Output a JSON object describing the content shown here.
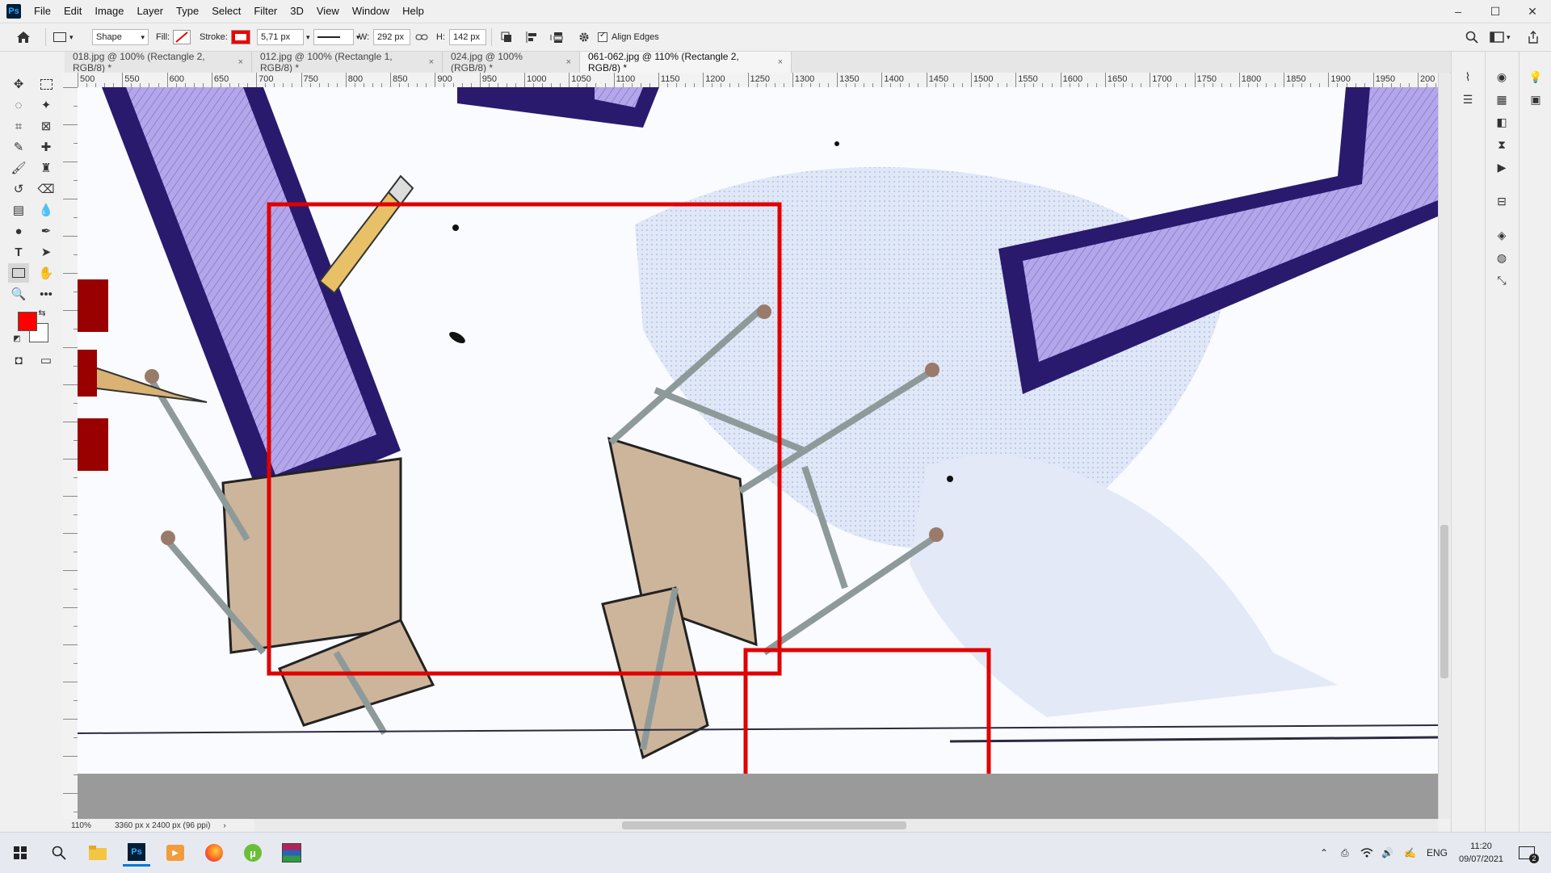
{
  "app": {
    "logo_text": "Ps"
  },
  "menu": [
    "File",
    "Edit",
    "Image",
    "Layer",
    "Type",
    "Select",
    "Filter",
    "3D",
    "View",
    "Window",
    "Help"
  ],
  "window_controls": {
    "minimize": "–",
    "maximize": "☐",
    "close": "✕"
  },
  "options": {
    "mode": "Shape",
    "fill_label": "Fill:",
    "stroke_label": "Stroke:",
    "stroke_width": "5,71 px",
    "w_label": "W:",
    "w_value": "292 px",
    "h_label": "H:",
    "h_value": "142 px",
    "align_edges": "Align Edges",
    "stroke_color": "#e00000"
  },
  "tabs": [
    {
      "label": "018.jpg @ 100% (Rectangle 2, RGB/8) *"
    },
    {
      "label": "012.jpg @ 100% (Rectangle 1, RGB/8) *"
    },
    {
      "label": "024.jpg @ 100% (RGB/8) *"
    },
    {
      "label": "061-062.jpg @ 110% (Rectangle 2, RGB/8) *"
    }
  ],
  "ruler": {
    "ticks": [
      "500",
      "550",
      "600",
      "650",
      "700",
      "750",
      "800",
      "850",
      "900",
      "950",
      "1000",
      "1050",
      "1100",
      "1150",
      "1200",
      "1250",
      "1300",
      "1350",
      "1400",
      "1450",
      "1500",
      "1550",
      "1600",
      "1650",
      "1700",
      "1750",
      "1800",
      "1850",
      "1900",
      "1950",
      "200"
    ]
  },
  "status": {
    "zoom": "110%",
    "doc_info": "3360 px x 2400 px (96 ppi)"
  },
  "colors": {
    "foreground": "#ff0000",
    "background": "#ffffff",
    "accent_purple": "#b3a7ea",
    "frame_navy": "#2a1a6e"
  },
  "taskbar": {
    "lang": "ENG",
    "time": "11:20",
    "date": "09/07/2021",
    "notifications": "2"
  }
}
